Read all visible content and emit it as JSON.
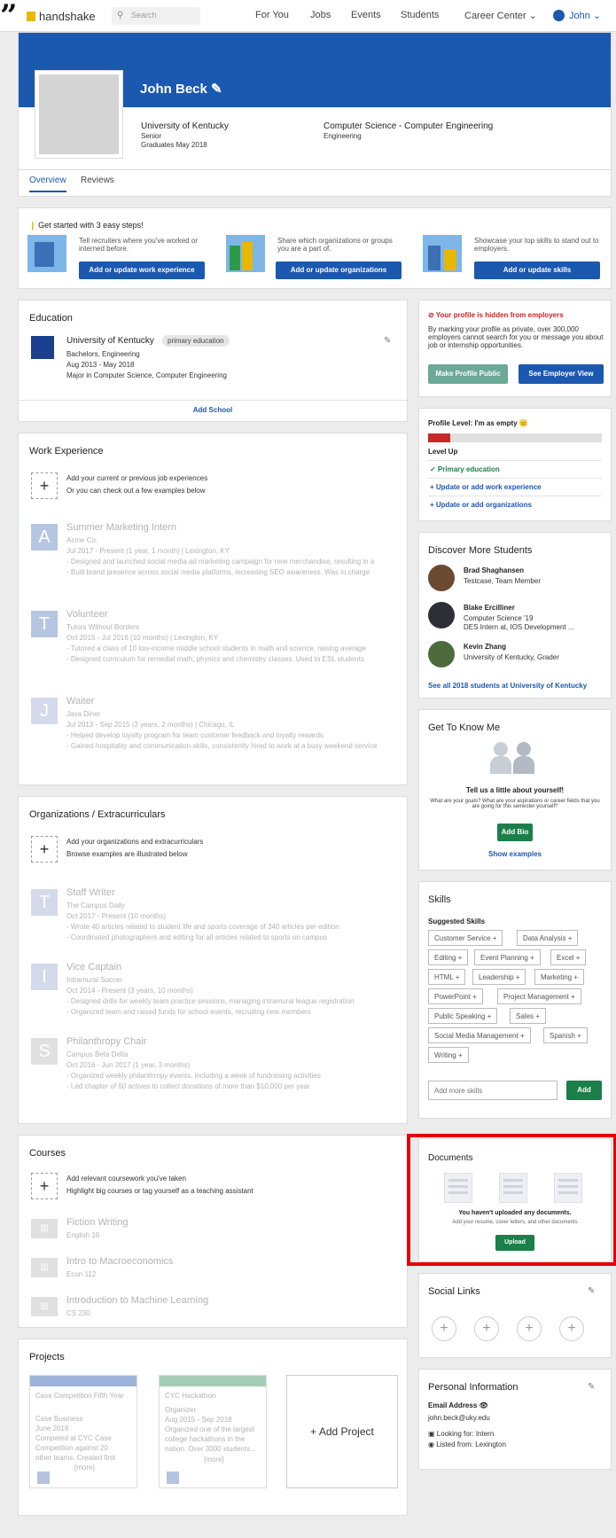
{
  "nav": {
    "logo": "handshake",
    "search_placeholder": "Search",
    "links": [
      "For You",
      "Jobs",
      "Events",
      "Students",
      "Career Center ⌄"
    ],
    "user": "John ⌄"
  },
  "profile": {
    "name": "John Beck",
    "school": "University of Kentucky",
    "level": "Senior",
    "graduation": "Graduates May 2018",
    "major": "Computer Science - Computer Engineering",
    "college": "Engineering"
  },
  "tabs": [
    "Overview",
    "Reviews"
  ],
  "getting_started": {
    "title": "Get started with 3 easy steps!",
    "steps": [
      {
        "text": "Tell recruiters where you've worked or interned before.",
        "button": "Add or update work experience"
      },
      {
        "text": "Share which organizations or groups you are a part of.",
        "button": "Add or update organizations"
      },
      {
        "text": "Showcase your top skills to stand out to employers.",
        "button": "Add or update skills"
      }
    ]
  },
  "education": {
    "title": "Education",
    "school": "University of Kentucky",
    "badge": "primary education",
    "degree": "Bachelors, Engineering",
    "dates": "Aug 2013 - May 2018",
    "major": "Major in Computer Science, Computer Engineering",
    "add": "Add School"
  },
  "work": {
    "title": "Work Experience",
    "prompt": "Add your current or previous job experiences",
    "hint": "Or you can check out a few examples below",
    "items": [
      {
        "letter": "A",
        "title": "Summer Marketing Intern",
        "org": "Acme Co.",
        "dates": "Jul 2017 - Present (1 year, 1 month) | Lexington, KY",
        "l1": "- Designed and launched social media ad marketing campaign for new merchandise, resulting in a",
        "l2": "- Built brand presence across social media platforms, increasing SEO awareness. Was in charge"
      },
      {
        "letter": "T",
        "title": "Volunteer",
        "org": "Tutors Without Borders",
        "dates": "Oct 2015 - Jul 2016 (10 months) | Lexington, KY",
        "l1": "- Tutored a class of 10 low-income middle school students in math and science, raising average",
        "l2": "- Designed curriculum for remedial math, physics and chemistry classes. Used to ESL students"
      },
      {
        "letter": "J",
        "title": "Waiter",
        "org": "Java Diner",
        "dates": "Jul 2013 - Sep 2015 (2 years, 2 months) | Chicago, IL",
        "l1": "- Helped develop loyalty program for team customer feedback and loyalty rewards",
        "l2": "- Gained hospitality and communication skills, consistently hired to work at a busy weekend service"
      }
    ]
  },
  "orgs": {
    "title": "Organizations / Extracurriculars",
    "prompt": "Add your organizations and extracurriculars",
    "hint": "Browse examples are illustrated below",
    "items": [
      {
        "letter": "T",
        "title": "Staff Writer",
        "org": "The Campus Daily",
        "dates": "Oct 2017 - Present (10 months)",
        "l1": "- Wrote 40 articles related to student life and sports coverage of 340 articles per edition",
        "l2": "- Coordinated photographers and editing for all articles related to sports on campus"
      },
      {
        "letter": "I",
        "title": "Vice Captain",
        "org": "Intramural Soccer",
        "dates": "Oct 2014 - Present (3 years, 10 months)",
        "l1": "- Designed drills for weekly team practice sessions, managing intramural league registration",
        "l2": "- Organized team and raised funds for school events, recruiting new members"
      },
      {
        "letter": "S",
        "title": "Philanthropy Chair",
        "org": "Campus Beta Delta",
        "dates": "Oct 2016 - Jun 2017 (1 year, 3 months)",
        "l1": "- Organized weekly philanthropy events, including a week of fundraising activities",
        "l2": "- Led chapter of 60 actives to collect donations of more than $10,000 per year"
      }
    ]
  },
  "courses": {
    "title": "Courses",
    "prompt": "Add relevant coursework you've taken",
    "hint": "Highlight big courses or tag yourself as a teaching assistant",
    "items": [
      {
        "title": "Fiction Writing",
        "code": "English 10"
      },
      {
        "title": "Intro to Macroeconomics",
        "code": "Econ 112"
      },
      {
        "title": "Introduction to Machine Learning",
        "code": "CS 230"
      }
    ]
  },
  "projects": {
    "title": "Projects",
    "items": [
      {
        "title": "Case Competition Fifth Year",
        "lines": [
          "Case Business",
          "June 2018",
          "Competed at CYC Case",
          "Competition against 20",
          "other teams. Created first"
        ],
        "more": "[more]"
      },
      {
        "title": "CYC Hackathon",
        "lines": [
          "Organizer",
          "Aug 2015 - Sep 2018",
          "Organized one of the largest",
          "college hackathons in the",
          "nation. Over 3000 students..."
        ],
        "more": "[more]"
      }
    ],
    "add": "+ Add Project"
  },
  "visibility": {
    "warning": "Your profile is hidden from employers",
    "text": "By marking your profile as private, over 300,000 employers cannot search for you or message you about job or internship opportunities.",
    "btn_public": "Make Profile Public",
    "btn_view": "See Employer View"
  },
  "profile_level": {
    "title": "Profile Level: I'm as empty 😐",
    "level_up": "Level Up",
    "fill": 0.13,
    "items": [
      "✓  Primary education",
      "+  Update or add work experience",
      "+  Update or add organizations"
    ]
  },
  "discover": {
    "title": "Discover More Students",
    "students": [
      {
        "name": "Brad Shaghansen",
        "sub": "Testcase, Team Member"
      },
      {
        "name": "Blake Ercilliner",
        "sub": "Computer Science '19",
        "sub2": "DES Intern at, IOS Development ..."
      },
      {
        "name": "Kevin Zhang",
        "sub": "University of Kentucky, Grader"
      }
    ],
    "see_all": "See all 2018 students at University of Kentucky"
  },
  "know_me": {
    "title": "Get To Know Me",
    "prompt": "Tell us a little about yourself!",
    "hint": "What are your goals? What are your aspirations or career fields that you are going for this semester yourself?",
    "btn": "Add Bio",
    "link": "Show examples"
  },
  "skills": {
    "title": "Skills",
    "suggested": "Suggested Skills",
    "items": [
      "Customer Service +",
      "Data Analysis +",
      "Editing +",
      "Event Planning +",
      "Excel +",
      "HTML +",
      "Leadership +",
      "Marketing +",
      "PowerPoint +",
      "Project Management +",
      "Public Speaking +",
      "Sales +",
      "Social Media Management +",
      "Spanish +",
      "Writing +"
    ],
    "input_placeholder": "Add more skills",
    "add_btn": "Add"
  },
  "documents": {
    "title": "Documents",
    "empty": "You haven't uploaded any documents.",
    "hint": "Add your resume, cover letters, and other documents",
    "btn": "Upload"
  },
  "social": {
    "title": "Social Links",
    "icons": [
      "+",
      "+",
      "+",
      "+"
    ]
  },
  "personal": {
    "title": "Personal Information",
    "email_label": "Email Address",
    "email": "john.beck@uky.edu",
    "l1": "Looking for: Intern",
    "l2": "Listed from: Lexington"
  }
}
